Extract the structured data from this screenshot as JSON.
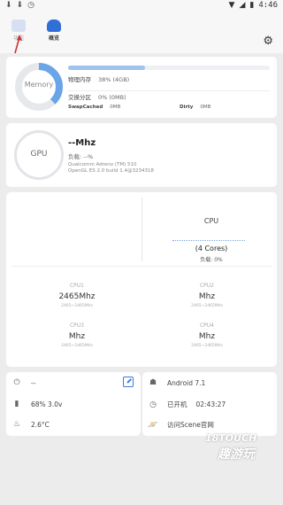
{
  "statusbar": {
    "time": "4:46"
  },
  "tabs": {
    "functions": "功能",
    "overview": "概览"
  },
  "memory": {
    "ring_label": "Memory",
    "ram_label": "物理内存",
    "ram_value": "38% (4GB)",
    "ram_fraction": 0.38,
    "swap_label": "交换分区",
    "swap_value": "0% (0MB)",
    "swapcached_label": "SwapCached",
    "swapcached_value": "0MB",
    "dirty_label": "Dirty",
    "dirty_value": "0MB"
  },
  "gpu": {
    "label": "GPU",
    "freq": "--Mhz",
    "load": "负载: --%",
    "renderer": "Qualcomm Adreno (TM) 510",
    "gl": "OpenGL ES 2.0 build 1.4@3234318"
  },
  "cpu": {
    "title": "CPU",
    "cores": "(4 Cores)",
    "load": "负载:  0%",
    "list": [
      {
        "name": "CPU1",
        "freq": "2465Mhz",
        "range": "2465~2465Mhz"
      },
      {
        "name": "CPU2",
        "freq": "Mhz",
        "range": "2465~2465Mhz"
      },
      {
        "name": "CPU3",
        "freq": "Mhz",
        "range": "2465~2465Mhz"
      },
      {
        "name": "CPU4",
        "freq": "Mhz",
        "range": "2465~2465Mhz"
      }
    ]
  },
  "device": {
    "power": "--",
    "battery": "68%  3.0v",
    "temp": "2.6°C"
  },
  "system": {
    "android": "Android 7.1",
    "uptime_label": "已开机",
    "uptime": "02:43:27",
    "website": "访问Scene官网"
  },
  "watermark": {
    "line1": "18TOUCH",
    "line2": "趣游玩"
  }
}
